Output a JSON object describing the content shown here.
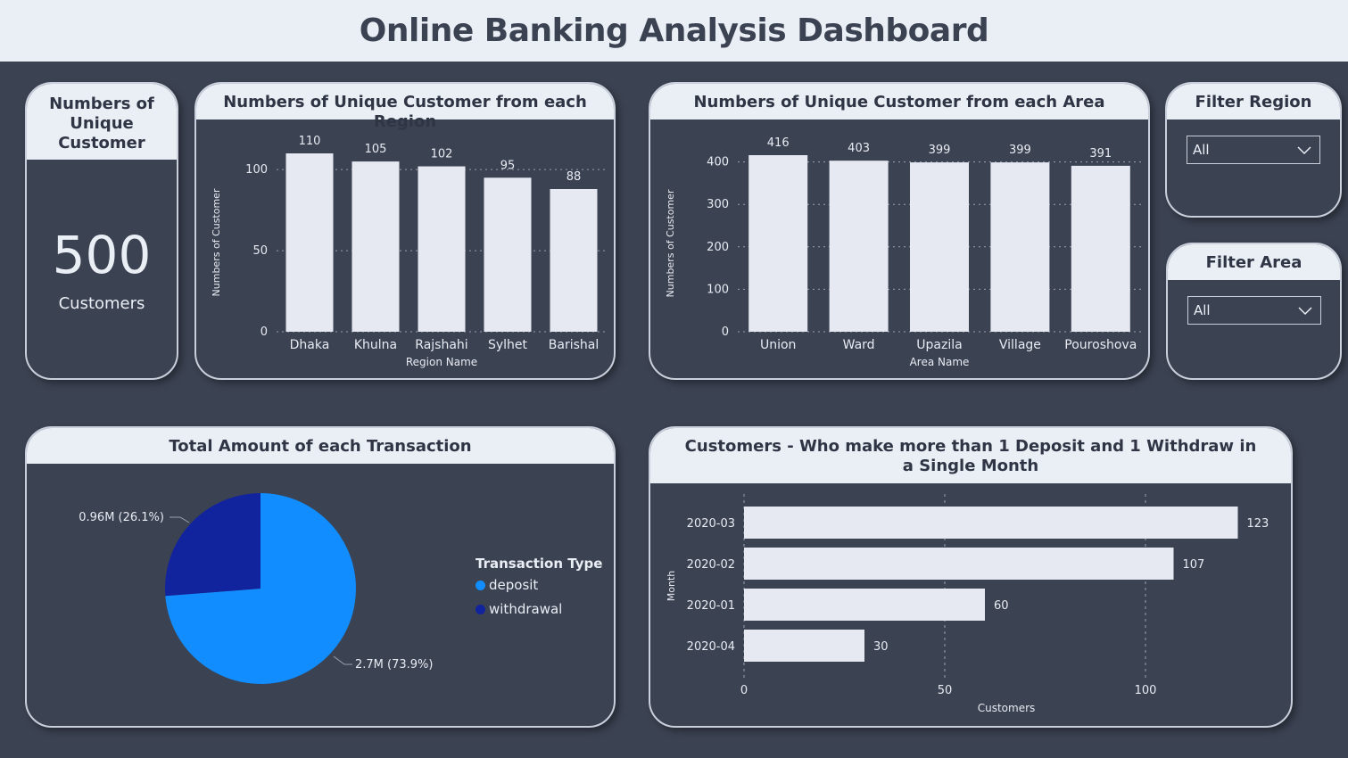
{
  "header": {
    "title": "Online Banking Analysis Dashboard"
  },
  "kpi": {
    "title": "Numbers of Unique Customer",
    "value": "500",
    "label": "Customers"
  },
  "filters": {
    "region": {
      "title": "Filter Region",
      "selected": "All"
    },
    "area": {
      "title": "Filter Area",
      "selected": "All"
    }
  },
  "colors": {
    "bar": "#e6e9f1",
    "deposit": "#118dff",
    "withdrawal": "#12239e"
  },
  "chart_data": [
    {
      "type": "bar",
      "title": "Numbers of Unique Customer from each Region",
      "categories": [
        "Dhaka",
        "Khulna",
        "Rajshahi",
        "Sylhet",
        "Barishal"
      ],
      "values": [
        110,
        105,
        102,
        95,
        88
      ],
      "xlabel": "Region Name",
      "ylabel": "Numbers of Customer",
      "yticks": [
        0,
        50,
        100
      ],
      "ylim": [
        0,
        110
      ],
      "grid": true
    },
    {
      "type": "bar",
      "title": "Numbers of Unique Customer from each Area",
      "categories": [
        "Union",
        "Ward",
        "Upazila",
        "Village",
        "Pouroshova"
      ],
      "values": [
        416,
        403,
        399,
        399,
        391
      ],
      "xlabel": "Area Name",
      "ylabel": "Numbers of Customer",
      "yticks": [
        0,
        100,
        200,
        300,
        400
      ],
      "ylim": [
        0,
        416
      ],
      "grid": true
    },
    {
      "type": "pie",
      "title": "Total Amount of each Transaction",
      "legend_title": "Transaction Type",
      "legend": "right",
      "slices": [
        {
          "name": "deposit",
          "value": 2.7,
          "label": "2.7M (73.9%)",
          "percent": 73.9
        },
        {
          "name": "withdrawal",
          "value": 0.96,
          "label": "0.96M (26.1%)",
          "percent": 26.1
        }
      ]
    },
    {
      "type": "bar",
      "orientation": "horizontal",
      "title": "Customers - Who make more than 1 Deposit and 1 Withdraw in a Single Month",
      "categories": [
        "2020-03",
        "2020-02",
        "2020-01",
        "2020-04"
      ],
      "values": [
        123,
        107,
        60,
        30
      ],
      "xlabel": "Customers",
      "ylabel": "Month",
      "xticks": [
        0,
        50,
        100
      ],
      "xlim": [
        0,
        123
      ],
      "grid": true
    }
  ]
}
